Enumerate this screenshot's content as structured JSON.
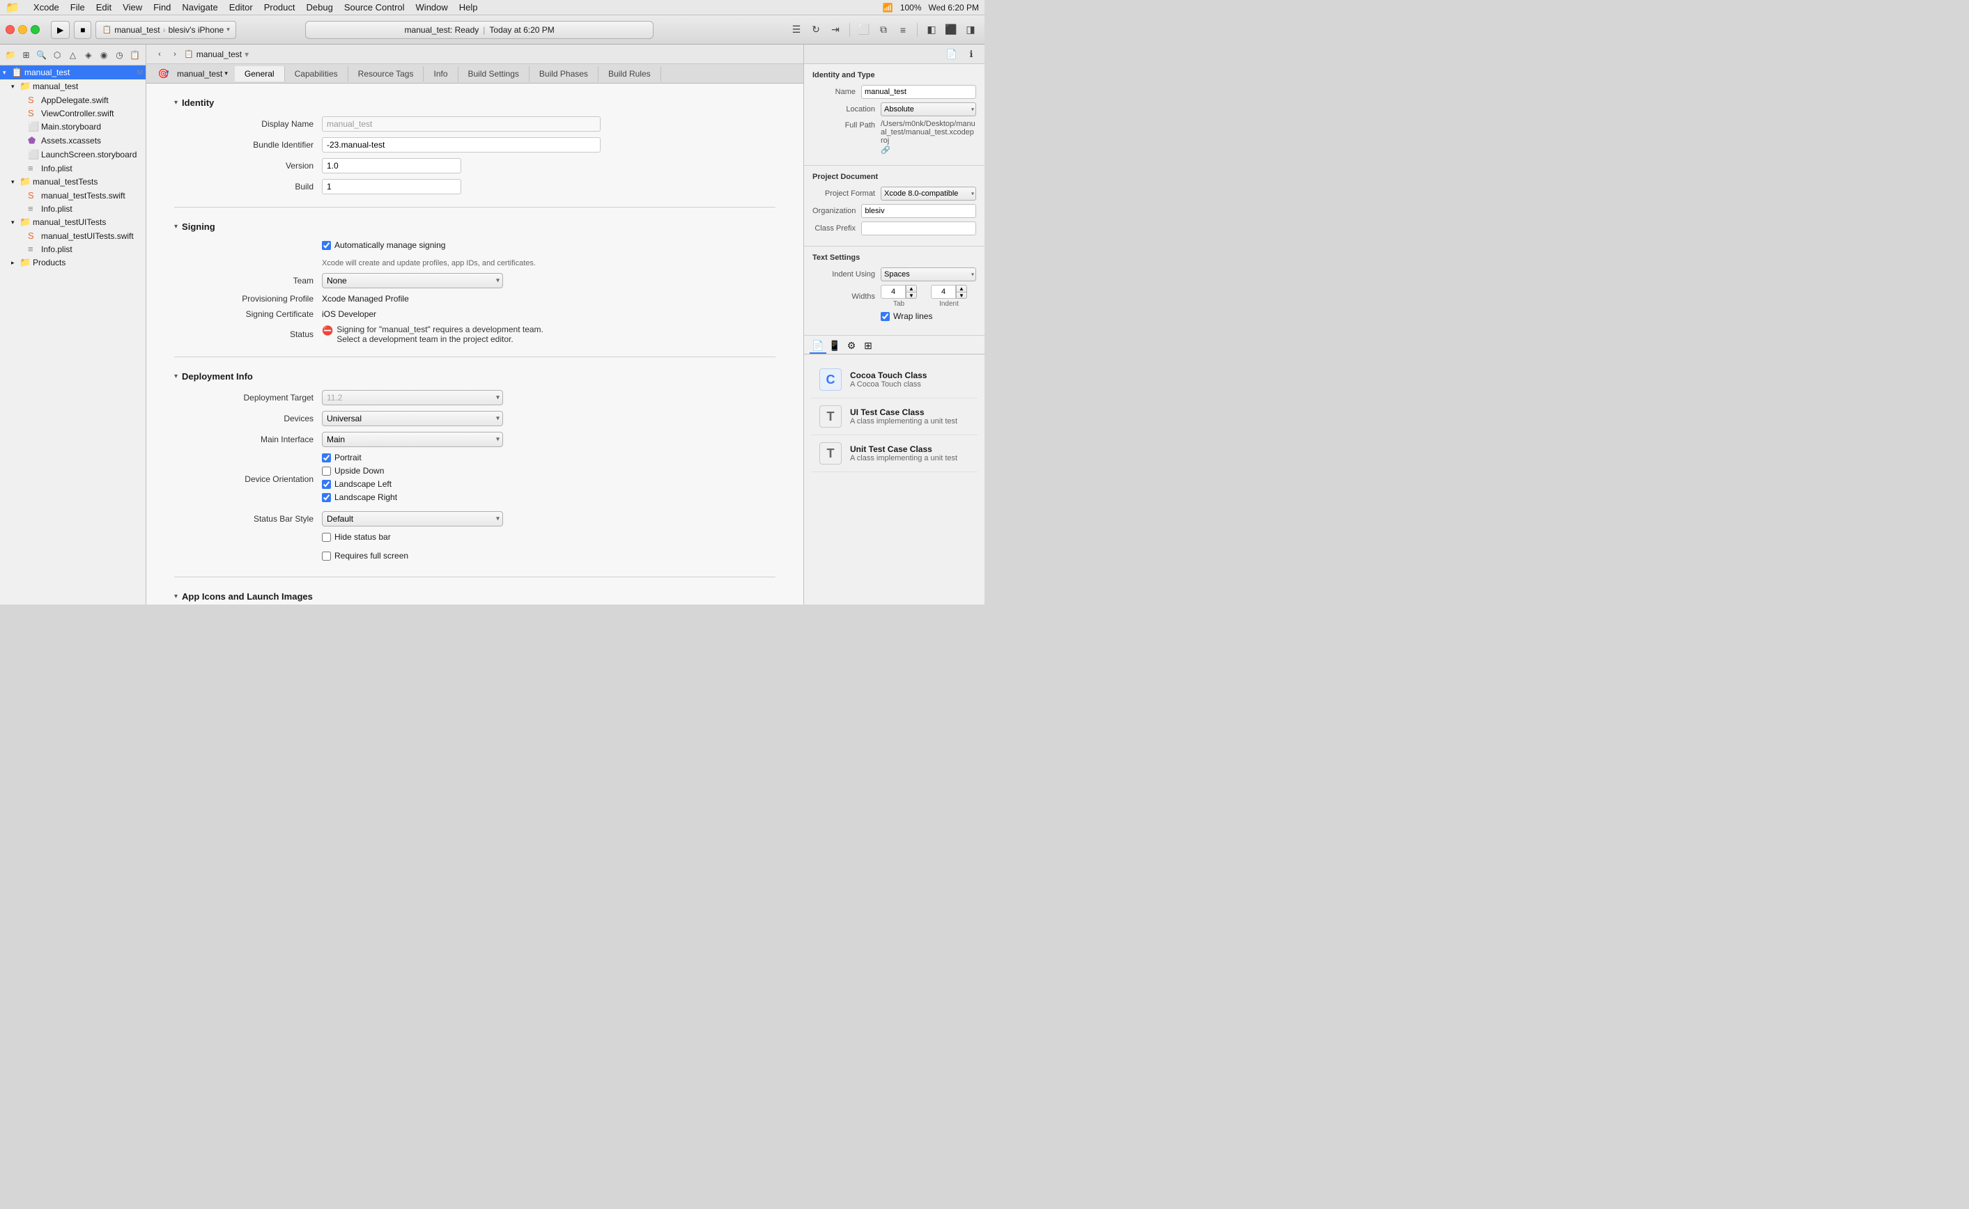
{
  "menubar": {
    "apple": "🍎",
    "items": [
      "Xcode",
      "File",
      "Edit",
      "View",
      "Find",
      "Navigate",
      "Editor",
      "Product",
      "Debug",
      "Source Control",
      "Window",
      "Help"
    ],
    "right": {
      "time": "Wed 6:20 PM",
      "battery": "100%"
    }
  },
  "toolbar": {
    "scheme": "manual_test",
    "device": "blesiv's iPhone",
    "status": "manual_test: Ready",
    "timestamp": "Today at 6:20 PM"
  },
  "breadcrumb": {
    "path": "manual_test"
  },
  "sidebar": {
    "project": "manual_test",
    "badge": "M",
    "items": [
      {
        "id": "manual_test_group",
        "label": "manual_test",
        "indent": 0,
        "type": "folder",
        "expanded": true
      },
      {
        "id": "app_delegate",
        "label": "AppDelegate.swift",
        "indent": 1,
        "type": "swift"
      },
      {
        "id": "view_controller",
        "label": "ViewController.swift",
        "indent": 1,
        "type": "swift"
      },
      {
        "id": "main_storyboard",
        "label": "Main.storyboard",
        "indent": 1,
        "type": "storyboard"
      },
      {
        "id": "assets",
        "label": "Assets.xcassets",
        "indent": 1,
        "type": "assets"
      },
      {
        "id": "launch_screen",
        "label": "LaunchScreen.storyboard",
        "indent": 1,
        "type": "storyboard"
      },
      {
        "id": "info_plist",
        "label": "Info.plist",
        "indent": 1,
        "type": "plist"
      },
      {
        "id": "manual_test_tests_group",
        "label": "manual_testTests",
        "indent": 0,
        "type": "folder",
        "expanded": true
      },
      {
        "id": "tests_swift",
        "label": "manual_testTests.swift",
        "indent": 1,
        "type": "swift"
      },
      {
        "id": "tests_info",
        "label": "Info.plist",
        "indent": 1,
        "type": "plist"
      },
      {
        "id": "manual_test_ui_group",
        "label": "manual_testUITests",
        "indent": 0,
        "type": "folder",
        "expanded": true
      },
      {
        "id": "ui_tests_swift",
        "label": "manual_testUITests.swift",
        "indent": 1,
        "type": "swift"
      },
      {
        "id": "ui_info",
        "label": "Info.plist",
        "indent": 1,
        "type": "plist"
      },
      {
        "id": "products_group",
        "label": "Products",
        "indent": 0,
        "type": "folder",
        "expanded": false
      }
    ]
  },
  "tabs": {
    "items": [
      "General",
      "Capabilities",
      "Resource Tags",
      "Info",
      "Build Settings",
      "Build Phases",
      "Build Rules"
    ],
    "active": "General"
  },
  "identity": {
    "section_title": "Identity",
    "display_name_label": "Display Name",
    "display_name_value": "manual_test",
    "bundle_id_label": "Bundle Identifier",
    "bundle_id_value": "-23.manual-test",
    "version_label": "Version",
    "version_value": "1.0",
    "build_label": "Build",
    "build_value": "1"
  },
  "signing": {
    "section_title": "Signing",
    "auto_label": "Automatically manage signing",
    "auto_checked": true,
    "auto_note": "Xcode will create and update profiles, app IDs, and certificates.",
    "team_label": "Team",
    "team_value": "None",
    "provisioning_label": "Provisioning Profile",
    "provisioning_value": "Xcode Managed Profile",
    "cert_label": "Signing Certificate",
    "cert_value": "iOS Developer",
    "status_label": "Status",
    "status_error": "Signing for \"manual_test\" requires a development team.",
    "status_error_sub": "Select a development team in the project editor."
  },
  "deployment": {
    "section_title": "Deployment Info",
    "target_label": "Deployment Target",
    "target_value": "11.2",
    "devices_label": "Devices",
    "devices_value": "Universal",
    "main_interface_label": "Main Interface",
    "main_interface_value": "Main",
    "orientation_label": "Device Orientation",
    "portrait_label": "Portrait",
    "portrait_checked": true,
    "upside_down_label": "Upside Down",
    "upside_down_checked": false,
    "landscape_left_label": "Landscape Left",
    "landscape_left_checked": true,
    "landscape_right_label": "Landscape Right",
    "landscape_right_checked": true,
    "status_bar_label": "Status Bar Style",
    "status_bar_value": "Default",
    "hide_status_label": "Hide status bar",
    "hide_status_checked": false,
    "requires_full_label": "Requires full screen",
    "requires_full_checked": false
  },
  "app_icons": {
    "section_title": "App Icons and Launch Images"
  },
  "inspector": {
    "identity_type_title": "Identity and Type",
    "name_label": "Name",
    "name_value": "manual_test",
    "location_label": "Location",
    "location_value": "Absolute",
    "full_path_label": "Full Path",
    "full_path_value": "/Users/m0nk/Desktop/manual_test/manual_test.xcodeproj",
    "project_doc_title": "Project Document",
    "proj_format_label": "Project Format",
    "proj_format_value": "Xcode 8.0-compatible",
    "org_label": "Organization",
    "org_value": "blesiv",
    "class_prefix_label": "Class Prefix",
    "class_prefix_value": "",
    "text_settings_title": "Text Settings",
    "indent_label": "Indent Using",
    "indent_value": "Spaces",
    "widths_label": "Widths",
    "tab_width": "4",
    "indent_width": "4",
    "tab_label": "Tab",
    "indent_label2": "Indent",
    "wrap_label": "Wrap lines",
    "wrap_checked": true
  },
  "templates": [
    {
      "icon": "C",
      "icon_type": "c",
      "name": "Cocoa Touch Class",
      "desc": "A Cocoa Touch class"
    },
    {
      "icon": "T",
      "icon_type": "t",
      "name": "UI Test Case Class",
      "desc": "A class implementing a unit test"
    },
    {
      "icon": "T",
      "icon_type": "t",
      "name": "Unit Test Case Class",
      "desc": "A class implementing a unit test"
    }
  ],
  "icons": {
    "play": "▶",
    "stop": "■",
    "scheme_arrow": "⌃",
    "chevron_right": "›",
    "chevron_left": "‹",
    "chevron_down": "▾",
    "chevron_right_small": "▸",
    "folder": "📁",
    "swift_file": "📄",
    "storyboard": "🖼",
    "plist": "📋",
    "assets": "📦",
    "document": "📄",
    "gear": "⚙",
    "info": "ℹ",
    "person": "👤",
    "plus": "+",
    "minus": "−",
    "link": "🔗"
  }
}
